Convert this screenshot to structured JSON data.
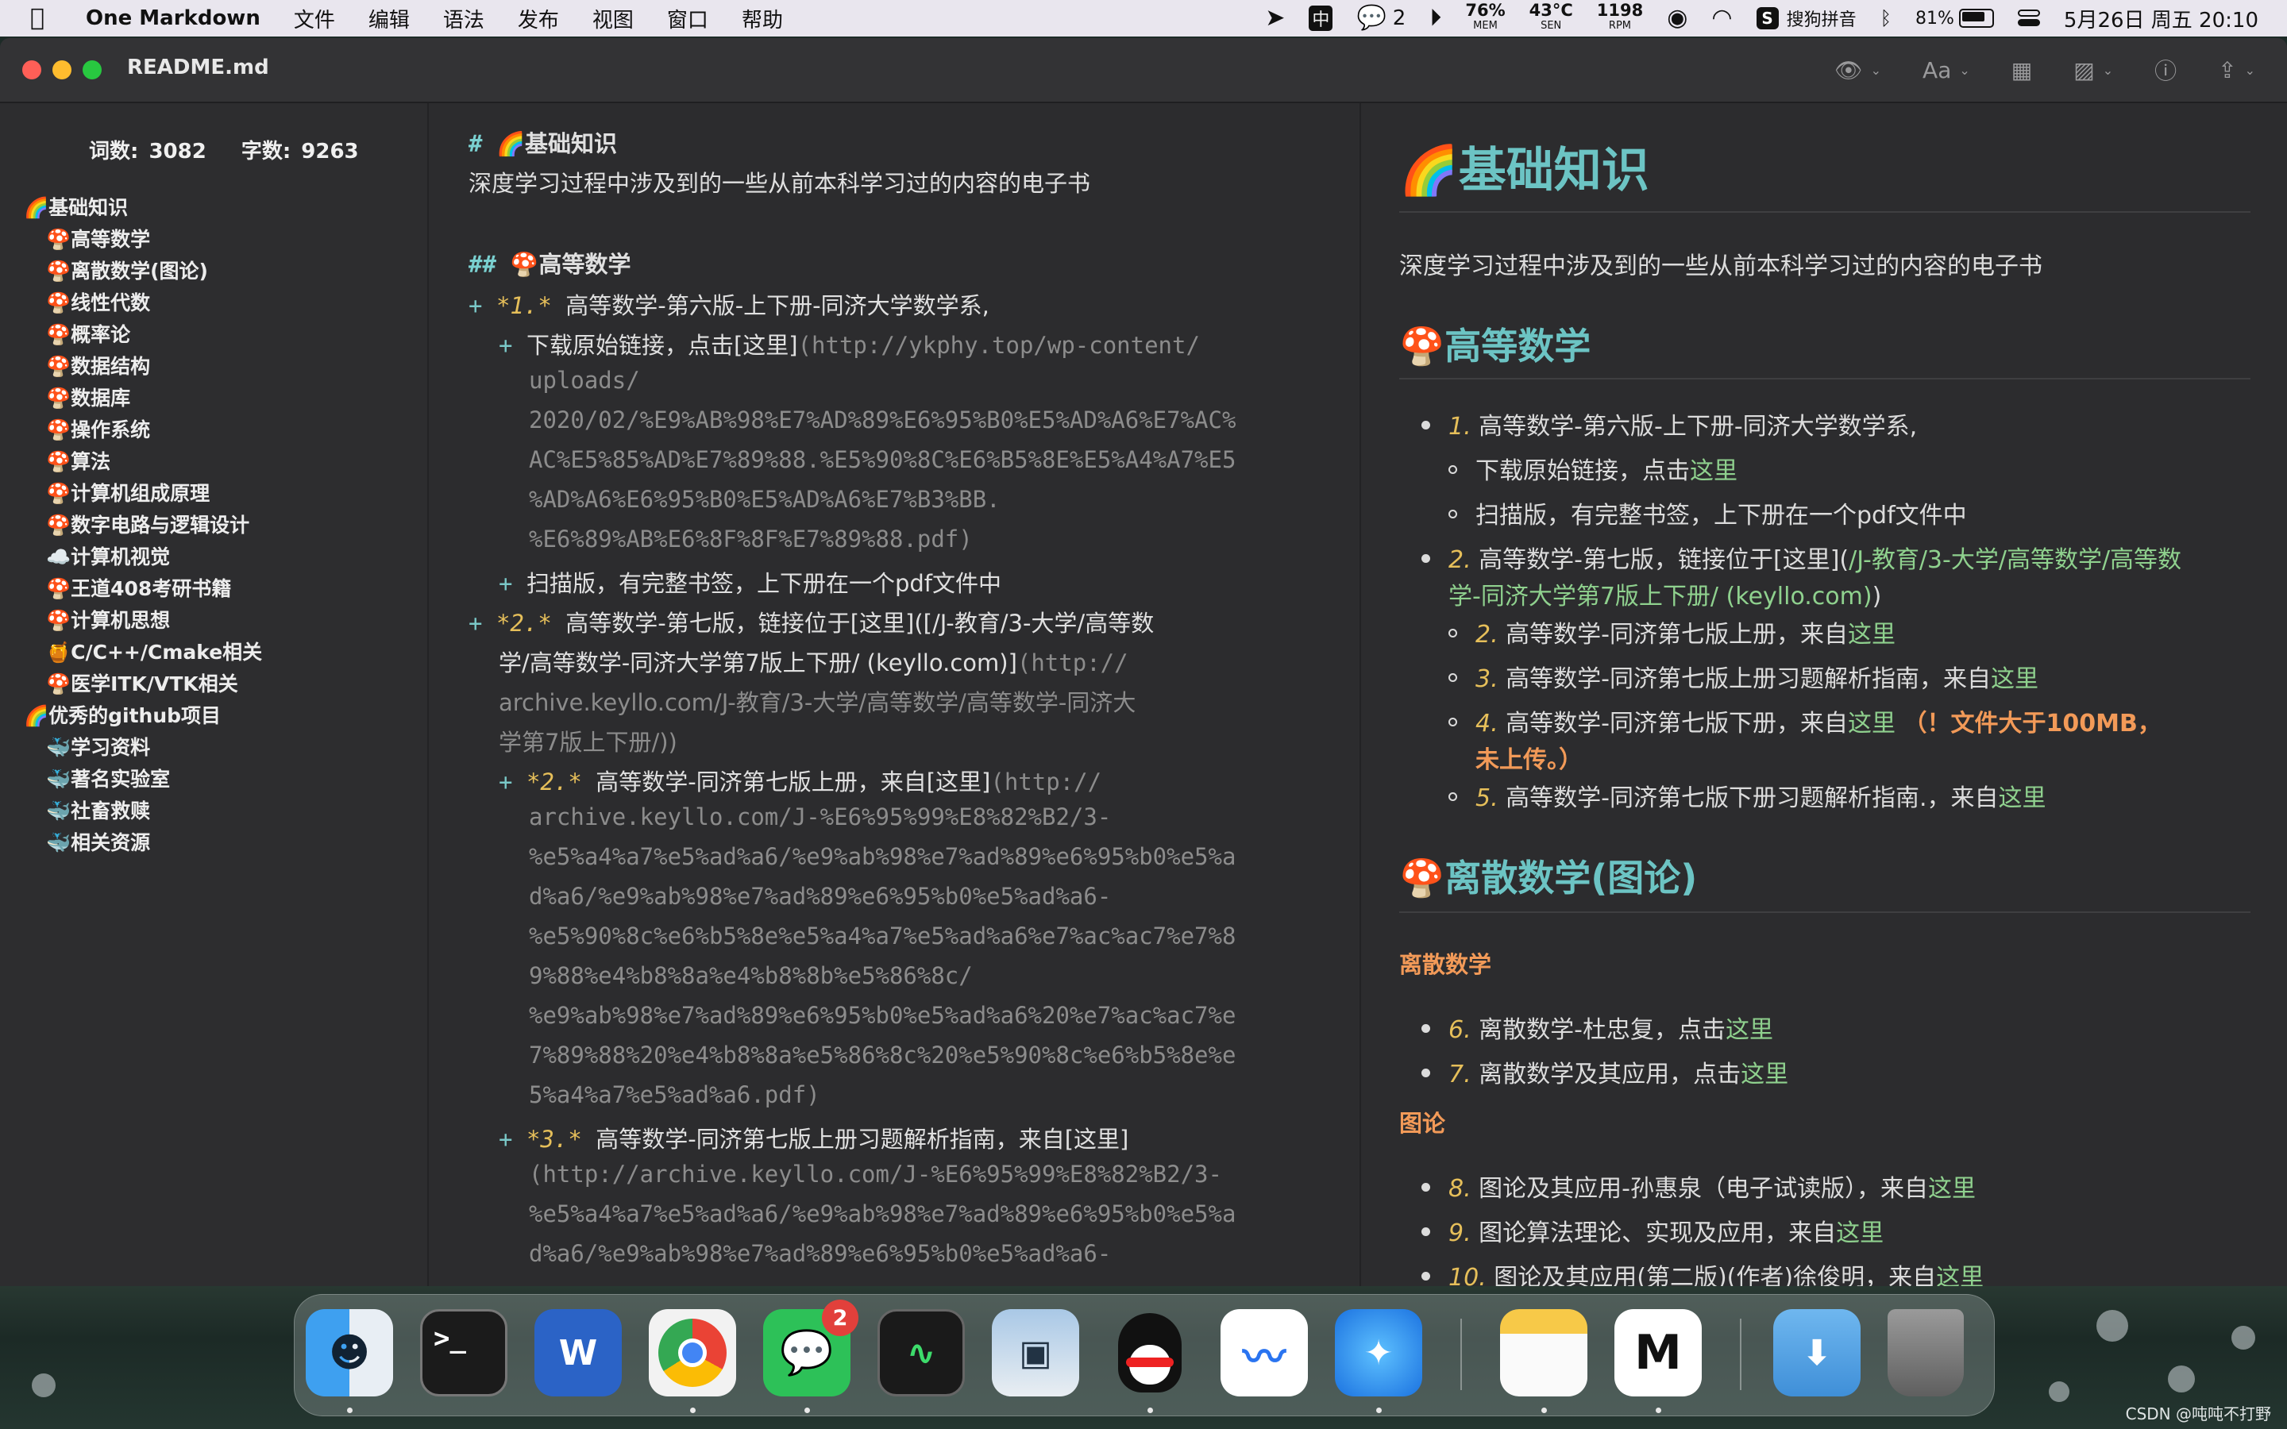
{
  "menubar": {
    "app_name": "One Markdown",
    "menus": [
      "文件",
      "编辑",
      "语法",
      "发布",
      "视图",
      "窗口",
      "帮助"
    ],
    "wechat_count": "2",
    "mem_value": "76%",
    "mem_label": "MEM",
    "sen_value": "43°C",
    "sen_label": "SEN",
    "rpm_value": "1198",
    "rpm_label": "RPM",
    "ime": "搜狗拼音",
    "battery": "81%",
    "datetime": "5月26日 周五 20:10",
    "input_source": "中"
  },
  "window": {
    "title": "README.md",
    "font_label": "Aa"
  },
  "sidebar": {
    "words": "词数: 3082",
    "chars": "字数: 9263",
    "toc": [
      {
        "label": "🌈基础知识",
        "level": 1
      },
      {
        "label": "🍄高等数学",
        "level": 2
      },
      {
        "label": "🍄离散数学(图论)",
        "level": 2
      },
      {
        "label": "🍄线性代数",
        "level": 2
      },
      {
        "label": "🍄概率论",
        "level": 2
      },
      {
        "label": "🍄数据结构",
        "level": 2
      },
      {
        "label": "🍄数据库",
        "level": 2
      },
      {
        "label": "🍄操作系统",
        "level": 2
      },
      {
        "label": "🍄算法",
        "level": 2
      },
      {
        "label": "🍄计算机组成原理",
        "level": 2
      },
      {
        "label": "🍄数字电路与逻辑设计",
        "level": 2
      },
      {
        "label": "☁️计算机视觉",
        "level": 2
      },
      {
        "label": "🍄王道408考研书籍",
        "level": 2
      },
      {
        "label": "🍄计算机思想",
        "level": 2
      },
      {
        "label": "🍯C/C++/Cmake相关",
        "level": 2
      },
      {
        "label": "🍄医学ITK/VTK相关",
        "level": 2
      },
      {
        "label": "🌈优秀的github项目",
        "level": 1
      },
      {
        "label": "🐳学习资料",
        "level": 2
      },
      {
        "label": "🐳著名实验室",
        "level": 2
      },
      {
        "label": "🐳社畜救赎",
        "level": 2
      },
      {
        "label": "🐳相关资源",
        "level": 2
      }
    ]
  },
  "editor": {
    "h1_mark": "#",
    "h1_text": "🌈基础知识",
    "intro": "深度学习过程中涉及到的一些从前本科学习过的内容的电子书",
    "h2_mark": "##",
    "h2_text": "🍄高等数学",
    "plus": "+",
    "item1_num": "*1.*",
    "item1_text": "高等数学-第六版-上下册-同济大学数学系,",
    "sub1_text": "下载原始链接，点击",
    "here_link": "[这里]",
    "sub1_url_1": "(http://ykphy.top/wp-content/",
    "sub1_url_2": "uploads/",
    "sub1_url_3": "2020/02/%E9%AB%98%E7%AD%89%E6%95%B0%E5%AD%A6%E7%AC%",
    "sub1_url_4": "AC%E5%85%AD%E7%89%88.%E5%90%8C%E6%B5%8E%E5%A4%A7%E5",
    "sub1_url_5": "%AD%A6%E6%95%B0%E5%AD%A6%E7%B3%BB.",
    "sub1_url_6": "%E6%89%AB%E6%8F%8F%E7%89%88.pdf)",
    "sub2_text": "扫描版，有完整书签，上下册在一个pdf文件中",
    "item2_num": "*2.*",
    "item2_text": "高等数学-第七版，链接位于[这里](",
    "item2_link_1": "[/J-教育/3-大学/高等数",
    "item2_link_2": "学/高等数学-同济大学第7版上下册/ (keyllo.com)]",
    "item2_url_1": "(http://",
    "item2_url_2": "archive.keyllo.com/J-教育/3-大学/高等数学/高等数学-同济大",
    "item2_url_3": "学第7版上下册/))",
    "s21_num": "*2.*",
    "s21_text": "高等数学-同济第七版上册，来自",
    "s21_url_1": "(http://",
    "s21_url_2": "archive.keyllo.com/J-%E6%95%99%E8%82%B2/3-",
    "s21_url_3": "%e5%a4%a7%e5%ad%a6/%e9%ab%98%e7%ad%89%e6%95%b0%e5%a",
    "s21_url_4": "d%a6/%e9%ab%98%e7%ad%89%e6%95%b0%e5%ad%a6-",
    "s21_url_5": "%e5%90%8c%e6%b5%8e%e5%a4%a7%e5%ad%a6%e7%ac%ac7%e7%8",
    "s21_url_6": "9%88%e4%b8%8a%e4%b8%8b%e5%86%8c/",
    "s21_url_7": "%e9%ab%98%e7%ad%89%e6%95%b0%e5%ad%a6%20%e7%ac%ac7%e",
    "s21_url_8": "7%89%88%20%e4%b8%8a%e5%86%8c%20%e5%90%8c%e6%b5%8e%e",
    "s21_url_9": "5%a4%a7%e5%ad%a6.pdf)",
    "s22_num": "*3.*",
    "s22_text": "高等数学-同济第七版上册习题解析指南，来自",
    "s22_url_1": "(http://archive.keyllo.com/J-%E6%95%99%E8%82%B2/3-",
    "s22_url_2": "%e5%a4%a7%e5%ad%a6/%e9%ab%98%e7%ad%89%e6%95%b0%e5%a",
    "s22_url_3": "d%a6/%e9%ab%98%e7%ad%89%e6%95%b0%e5%ad%a6-"
  },
  "preview": {
    "h1": "🌈基础知识",
    "intro": "深度学习过程中涉及到的一些从前本科学习过的内容的电子书",
    "h2_math": "🍄高等数学",
    "m1_num": "1.",
    "m1_text": "高等数学-第六版-上下册-同济大学数学系,",
    "m1a_text": "下载原始链接，点击",
    "here": "这里",
    "m1b_text": "扫描版，有完整书签，上下册在一个pdf文件中",
    "m2_num": "2.",
    "m2_text": "高等数学-第七版，链接位于[这里](",
    "m2_link_1": "/J-教育/3-大学/高等数学/高等数",
    "m2_link_2": "学-同济大学第7版上下册/ (keyllo.com)",
    "m2_close": ")",
    "m2a_num": "2.",
    "m2a_text": "高等数学-同济第七版上册，来自",
    "m2b_num": "3.",
    "m2b_text": "高等数学-同济第七版上册习题解析指南，来自",
    "m2c_num": "4.",
    "m2c_text": "高等数学-同济第七版下册，来自",
    "m2c_warn_1": "（！文件大于100MB，",
    "m2c_warn_2": "未上传。）",
    "m2d_num": "5.",
    "m2d_text": "高等数学-同济第七版下册习题解析指南.，来自",
    "h2_discrete": "🍄离散数学(图论)",
    "h4_discrete": "离散数学",
    "d6_num": "6.",
    "d6_text": "离散数学-杜忠复，点击",
    "d7_num": "7.",
    "d7_text": "离散数学及其应用，点击",
    "h4_graph": "图论",
    "g8_num": "8.",
    "g8_text": "图论及其应用-孙惠泉（电子试读版），来自",
    "g9_num": "9.",
    "g9_text": "图论算法理论、实现及应用，来自",
    "g10_num": "10.",
    "g10_text": "图论及其应用(第二版)(作者)徐俊明，来自"
  },
  "dock": {
    "terminal_glyph": ">_",
    "word_glyph": "W",
    "wechat_badge": "2"
  },
  "watermark": "CSDN @吨吨不打野"
}
